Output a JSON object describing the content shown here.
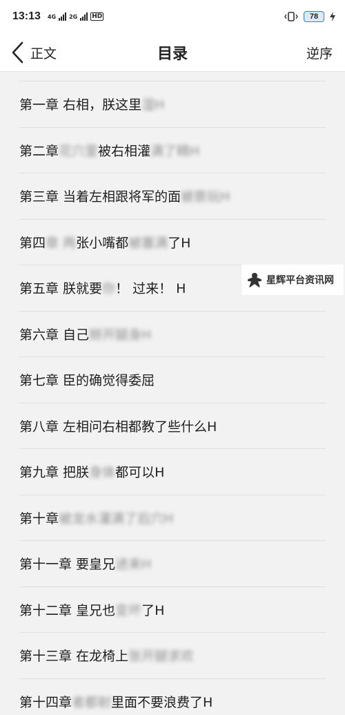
{
  "status_bar": {
    "time": "13:13",
    "net1": "4G",
    "net2": "2G",
    "hd": "HD",
    "battery": "78"
  },
  "header": {
    "back_label": "正文",
    "title": "目录",
    "reverse_label": "逆序"
  },
  "chapters": [
    {
      "clear": "第一章 右相，朕这里",
      "blurred": "湿H"
    },
    {
      "clear": "第二章 ",
      "blurred": "花穴里",
      "clear2": "被右相灌",
      "blurred2": "满了精H"
    },
    {
      "clear": "第三章 当着左相跟将军的面",
      "blurred": "被亵玩H"
    },
    {
      "clear": "第四",
      "blurred": "章 两",
      "clear2": "张小嘴都",
      "blurred2": "被塞满",
      "clear3": "了H"
    },
    {
      "clear": "第五章 朕就要",
      "blurred": "你",
      "clear2": "！ 过来！ H"
    },
    {
      "clear": "第六章 自己",
      "blurred": "掰开腿身H"
    },
    {
      "clear": "第七章 臣的确觉得委屈"
    },
    {
      "clear": "第八章 左相问右相都教了些什么H"
    },
    {
      "clear": "第九章 把朕",
      "blurred": "身体",
      "clear2": "都可以H"
    },
    {
      "clear": "第十章 ",
      "blurred": "被龙水灌满了后穴H"
    },
    {
      "clear": "第十一章 要皇兄",
      "blurred": "进来H"
    },
    {
      "clear": "第十二章 皇兄也",
      "blurred": "变坏",
      "clear2": "了H"
    },
    {
      "clear": "第十三章 在龙椅上",
      "blurred": "张开腿求欢"
    },
    {
      "clear": "第十四章 ",
      "blurred": "者都射",
      "clear2": "里面不要浪费了H"
    }
  ],
  "watermark": {
    "text": "星辉平台资讯网"
  }
}
